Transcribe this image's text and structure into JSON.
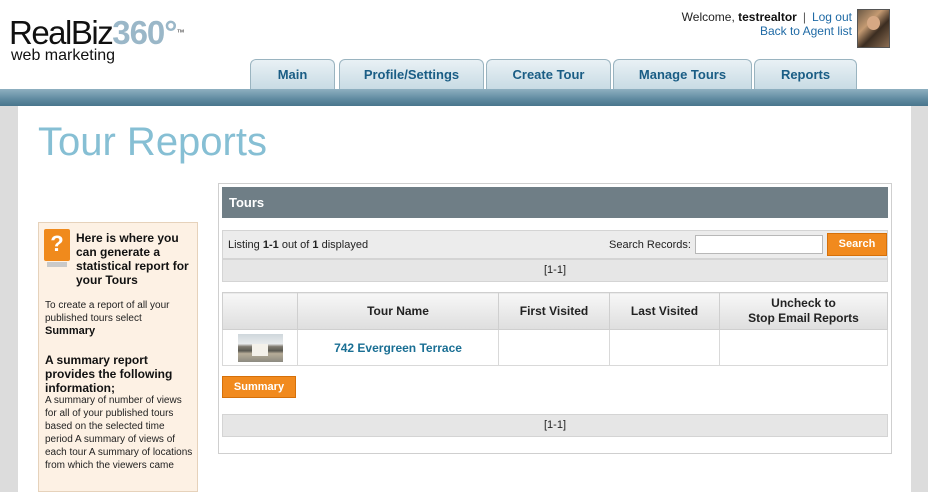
{
  "brand": {
    "name_part1": "RealBiz",
    "name_part2": "360°",
    "trademark": "™",
    "tagline": "web marketing"
  },
  "user": {
    "welcome": "Welcome, ",
    "username": "testrealtor",
    "separator": "|",
    "logout": "Log out",
    "back_link": "Back to Agent list"
  },
  "tabs": [
    {
      "label": "Main"
    },
    {
      "label": "Profile/Settings"
    },
    {
      "label": "Create Tour"
    },
    {
      "label": "Manage Tours"
    },
    {
      "label": "Reports"
    }
  ],
  "page": {
    "title": "Tour Reports"
  },
  "help": {
    "icon": "question-icon",
    "icon_glyph": "?",
    "heading": "Here is where you can generate a statistical report for your Tours",
    "text1": "To create a report of all your published tours select",
    "text1_strong": "Summary",
    "sub_heading": "A summary report provides the following information;",
    "text2": "A summary of number of views for all of your published tours based on the selected time period A summary of views of each tour A summary of locations from which the viewers came"
  },
  "tours": {
    "panel_title": "Tours",
    "listing_prefix": "Listing ",
    "listing_range": "1-1",
    "listing_middle": " out of ",
    "listing_total": "1",
    "listing_suffix": " displayed",
    "search_label": "Search Records:",
    "search_value": "",
    "search_button": "Search",
    "pager_top": "[1-1]",
    "pager_bottom": "[1-1]",
    "columns": [
      "",
      "Tour Name",
      "First Visited",
      "Last Visited",
      "Uncheck to\nStop Email Reports"
    ],
    "rows": [
      {
        "thumbnail": "house-photo",
        "tour_name": "742 Evergreen Terrace",
        "first_visited": "",
        "last_visited": "",
        "email_reports": ""
      }
    ],
    "summary_button": "Summary"
  },
  "colors": {
    "accent_orange": "#f18a1e",
    "title_blue": "#86bfd4",
    "link_blue": "#1a6f94",
    "header_bar": "#6f7e86"
  }
}
